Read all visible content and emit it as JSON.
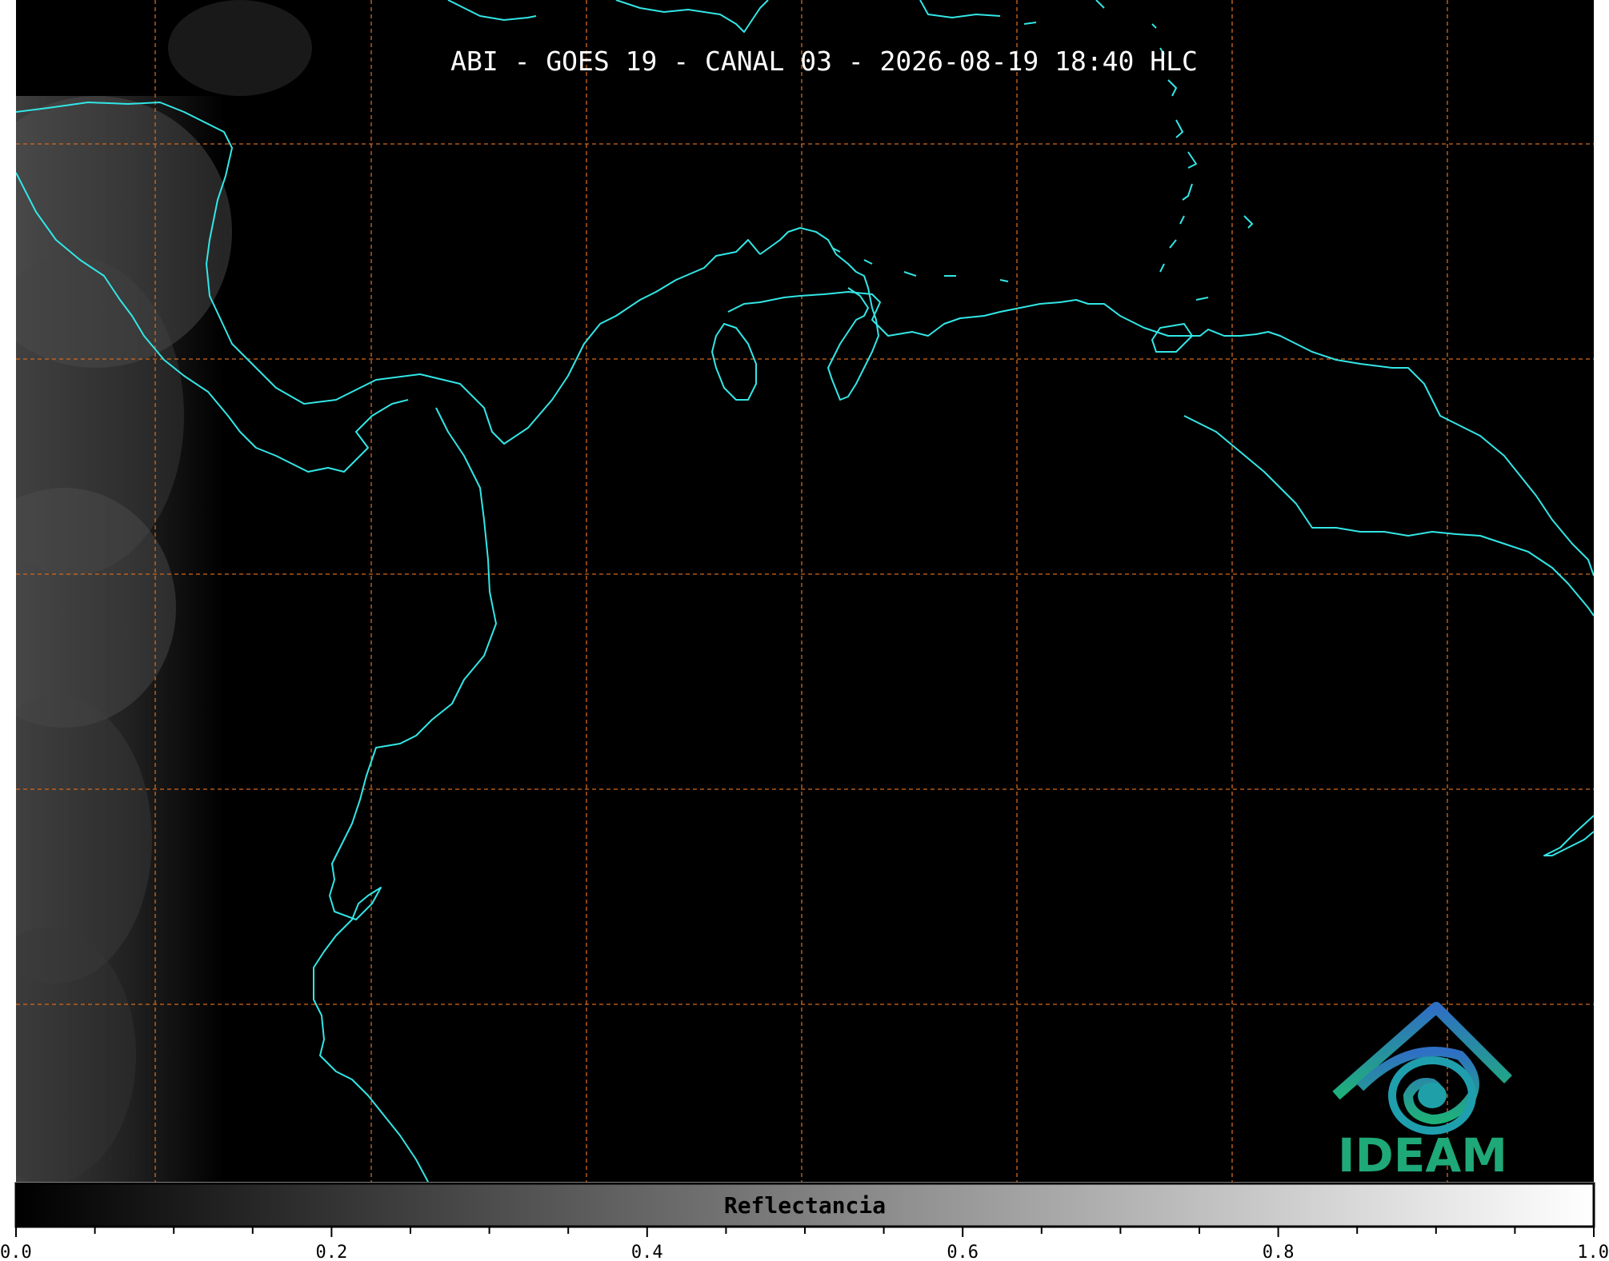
{
  "map": {
    "title": "ABI - GOES 19 - CANAL 03 - 2026-08-19 18:40 HLC",
    "background_color": "#000000",
    "coastline_color": "#33e6e6",
    "graticule_color": "#d2691e"
  },
  "colorbar": {
    "label": "Reflectancia",
    "colormap": "grayscale",
    "range": [
      0.0,
      1.0
    ],
    "major_ticks": [
      "0.0",
      "0.2",
      "0.4",
      "0.6",
      "0.8",
      "1.0"
    ]
  },
  "logo": {
    "text": "IDEAM",
    "icon": "ideam-logo-icon",
    "colors": [
      "#2b7fbf",
      "#1fa878"
    ]
  }
}
